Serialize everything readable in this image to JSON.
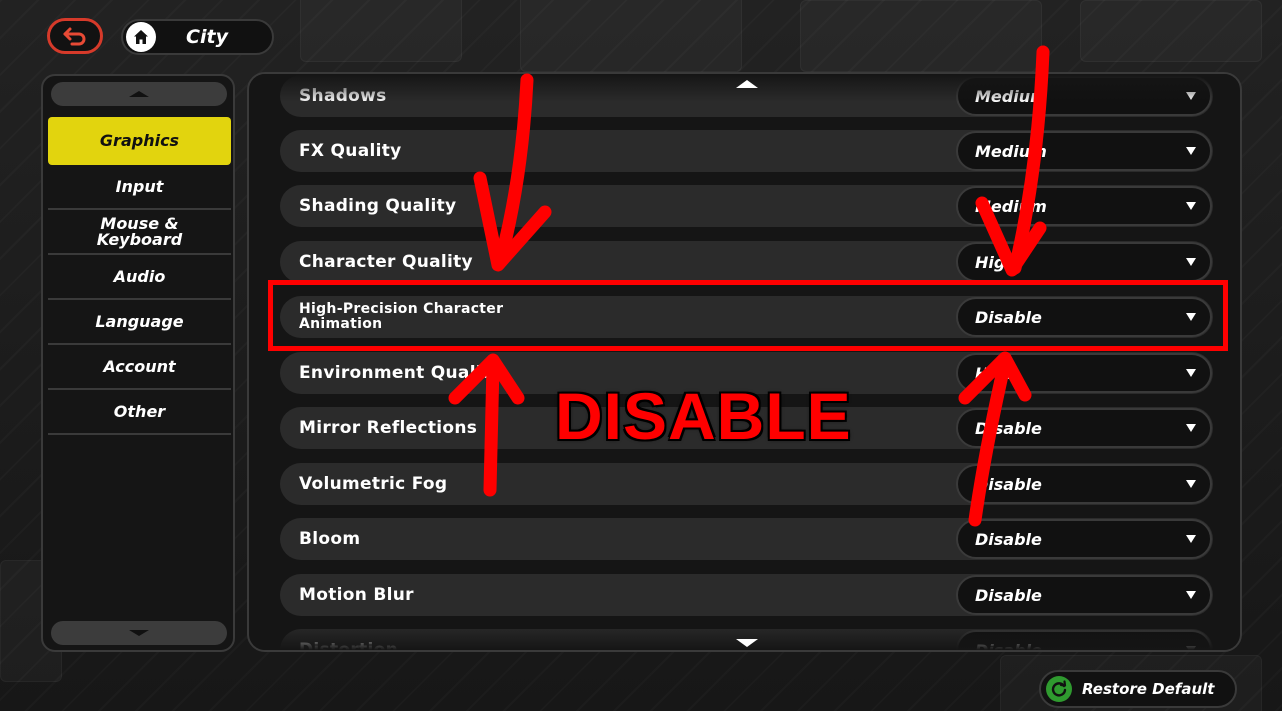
{
  "header": {
    "breadcrumb_label": "City"
  },
  "sidebar": {
    "items": [
      {
        "label": "Graphics",
        "active": true
      },
      {
        "label": "Input",
        "active": false
      },
      {
        "label": "Mouse &\nKeyboard",
        "active": false
      },
      {
        "label": "Audio",
        "active": false
      },
      {
        "label": "Language",
        "active": false
      },
      {
        "label": "Account",
        "active": false
      },
      {
        "label": "Other",
        "active": false
      }
    ]
  },
  "settings": [
    {
      "label": "Shadows",
      "value": "Medium"
    },
    {
      "label": "FX Quality",
      "value": "Medium"
    },
    {
      "label": "Shading Quality",
      "value": "Medium"
    },
    {
      "label": "Character Quality",
      "value": "High"
    },
    {
      "label": "High-Precision Character\nAnimation",
      "value": "Disable"
    },
    {
      "label": "Environment Quality",
      "value": "High"
    },
    {
      "label": "Mirror Reflections",
      "value": "Disable"
    },
    {
      "label": "Volumetric Fog",
      "value": "Disable"
    },
    {
      "label": "Bloom",
      "value": "Disable"
    },
    {
      "label": "Motion Blur",
      "value": "Disable"
    },
    {
      "label": "Distortion",
      "value": "Disable"
    }
  ],
  "annotation": {
    "text": "DISABLE",
    "color": "#ff0000"
  },
  "footer": {
    "restore_label": "Restore Default"
  },
  "colors": {
    "active_tab": "#e2d40e",
    "back_button_border": "#d63a2a",
    "restore_icon": "#2f9a2f"
  },
  "icons": {
    "back": "back-arrow-icon",
    "home": "home-icon",
    "restore": "refresh-icon",
    "dropdown": "caret-down-icon"
  }
}
